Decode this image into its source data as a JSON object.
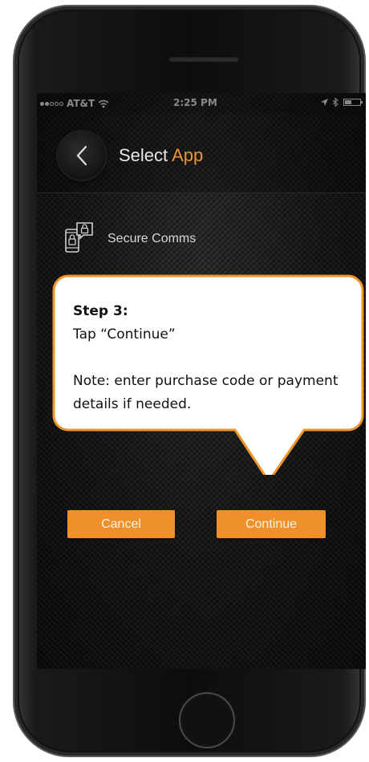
{
  "status_bar": {
    "carrier": "AT&T",
    "time": "2:25 PM"
  },
  "header": {
    "title_main": "Select",
    "title_accent": "App",
    "back_icon": "chevron-left-icon"
  },
  "app_item": {
    "icon": "secure-comms-icon",
    "label": "Secure Comms"
  },
  "buttons": {
    "cancel_label": "Cancel",
    "continue_label": "Continue"
  },
  "callout": {
    "step_title": "Step 3:",
    "instruction": "Tap “Continue”",
    "note": "Note: enter purchase code or payment details if needed."
  },
  "colors": {
    "accent": "#f0902a",
    "callout_border": "#f0952a",
    "screen_bg": "#141414"
  }
}
